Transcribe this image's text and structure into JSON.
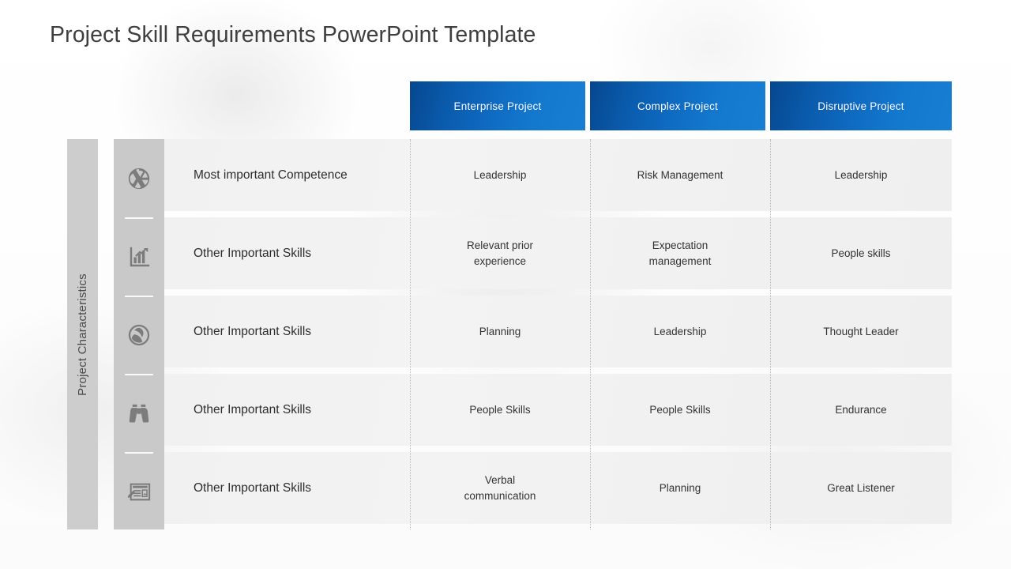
{
  "slide": {
    "title": "Project Skill Requirements PowerPoint Template"
  },
  "colors": {
    "header_blue_dark": "#06478f",
    "header_blue_light": "#177ed4",
    "sidebar_gray": "#cdcdcd",
    "icon_gray": "#7c7c7c",
    "row_gray": "#f1f1f1",
    "title_text": "#3f3f3f"
  },
  "sidebar": {
    "vertical_label": "Project Characteristics",
    "icons": [
      {
        "name": "aperture-icon"
      },
      {
        "name": "bar-chart-growth-icon"
      },
      {
        "name": "beach-ball-icon"
      },
      {
        "name": "binoculars-icon"
      },
      {
        "name": "news-article-icon"
      }
    ]
  },
  "table": {
    "columns": [
      {
        "label": "Enterprise Project"
      },
      {
        "label": "Complex Project"
      },
      {
        "label": "Disruptive  Project"
      }
    ],
    "rows": [
      {
        "label": "Most important Competence",
        "values": [
          "Leadership",
          "Risk Management",
          "Leadership"
        ]
      },
      {
        "label": "Other Important Skills",
        "values": [
          "Relevant prior\nexperience",
          "Expectation\nmanagement",
          "People skills"
        ]
      },
      {
        "label": "Other Important Skills",
        "values": [
          "Planning",
          "Leadership",
          "Thought  Leader"
        ]
      },
      {
        "label": "Other Important Skills",
        "values": [
          "People Skills",
          "People Skills",
          "Endurance"
        ]
      },
      {
        "label": "Other Important Skills",
        "values": [
          "Verbal\ncommunication",
          "Planning",
          "Great Listener"
        ]
      }
    ]
  }
}
